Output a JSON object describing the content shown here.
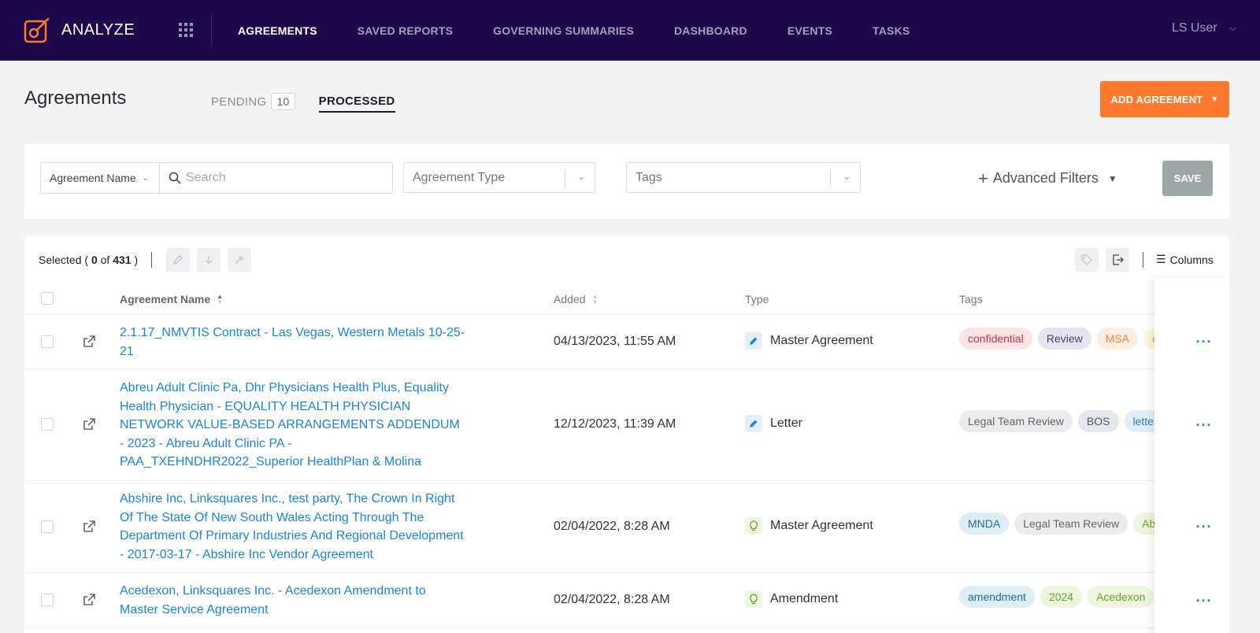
{
  "app": {
    "name": "ANALYZE"
  },
  "nav": {
    "items": [
      {
        "label": "AGREEMENTS",
        "active": true
      },
      {
        "label": "SAVED REPORTS",
        "active": false
      },
      {
        "label": "GOVERNING SUMMARIES",
        "active": false
      },
      {
        "label": "DASHBOARD",
        "active": false
      },
      {
        "label": "EVENTS",
        "active": false
      },
      {
        "label": "TASKS",
        "active": false
      }
    ],
    "user": "LS User"
  },
  "page": {
    "title": "Agreements",
    "tabs": {
      "pending_label": "PENDING",
      "pending_count": "10",
      "processed_label": "PROCESSED"
    },
    "add_button": "ADD AGREEMENT"
  },
  "filters": {
    "name_select": "Agreement Name",
    "search_placeholder": "Search",
    "type_placeholder": "Agreement Type",
    "tags_placeholder": "Tags",
    "advanced": "Advanced Filters",
    "save": "SAVE"
  },
  "toolbar": {
    "selected_prefix": "Selected (",
    "selected_count": "0",
    "selected_of": "of",
    "total": "431",
    "selected_suffix": ")",
    "columns": "Columns"
  },
  "table": {
    "headers": {
      "name": "Agreement Name",
      "added": "Added",
      "type": "Type",
      "tags": "Tags"
    },
    "rows": [
      {
        "name": "2.1.17_NMVTIS Contract - Las Vegas, Western Metals 10-25-21",
        "added": "04/13/2023, 11:55 AM",
        "type": "Master Agreement",
        "type_icon": "pencil-icon",
        "tags": [
          {
            "label": "confidential",
            "color": "red"
          },
          {
            "label": "Review",
            "color": "purple"
          },
          {
            "label": "MSA",
            "color": "orange"
          },
          {
            "label": "co",
            "color": "yellow"
          }
        ]
      },
      {
        "name": "Abreu Adult Clinic Pa, Dhr Physicians Health Plus, Equality Health Physician - EQUALITY HEALTH PHYSICIAN NETWORK VALUE-BASED ARRANGEMENTS ADDENDUM - 2023 - Abreu Adult Clinic PA - PAA_TXEHNDHR2022_Superior HealthPlan & Molina",
        "added": "12/12/2023, 11:39 AM",
        "type": "Letter",
        "type_icon": "pencil-icon",
        "tags": [
          {
            "label": "Legal Team Review",
            "color": "gray"
          },
          {
            "label": "BOS",
            "color": "slate"
          },
          {
            "label": "letter",
            "color": "blue"
          }
        ]
      },
      {
        "name": "Abshire Inc, Linksquares Inc., test party, The Crown In Right Of The State Of New South Wales Acting Through The Department Of Primary Industries And Regional Development - 2017-03-17 - Abshire Inc Vendor Agreement",
        "added": "02/04/2022, 8:28 AM",
        "type": "Master Agreement",
        "type_icon": "lightbulb-icon",
        "tags": [
          {
            "label": "MNDA",
            "color": "teal"
          },
          {
            "label": "Legal Team Review",
            "color": "gray"
          },
          {
            "label": "Abs",
            "color": "green"
          }
        ]
      },
      {
        "name": "Acedexon, Linksquares Inc. - Acedexon Amendment to Master Service Agreement",
        "added": "02/04/2022, 8:28 AM",
        "type": "Amendment",
        "type_icon": "lightbulb-icon",
        "tags": [
          {
            "label": "amendment",
            "color": "teal"
          },
          {
            "label": "2024",
            "color": "green"
          },
          {
            "label": "Acedexon",
            "color": "green"
          }
        ]
      }
    ]
  },
  "colors": {
    "nav_bg": "#1e0a4a",
    "accent": "#ff7a2f",
    "link": "#1a86d9",
    "save_disabled": "#9ea7a8"
  }
}
